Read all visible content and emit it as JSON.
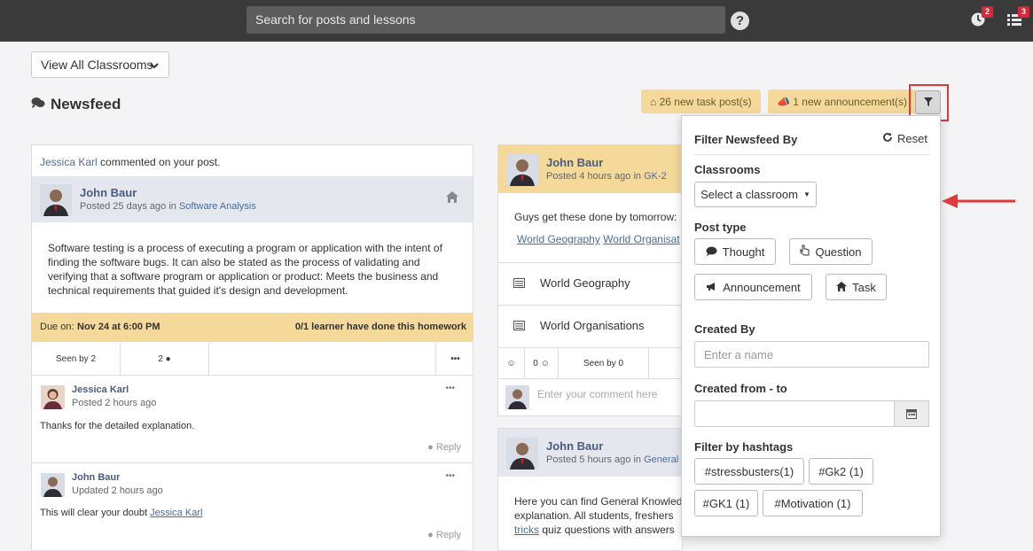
{
  "topbar": {
    "search_placeholder": "Search for posts and lessons",
    "help_label": "?",
    "notifications_count": "2",
    "list_count": "3"
  },
  "classroom_button": {
    "label": "View All Classrooms"
  },
  "newsfeed": {
    "title": "Newsfeed"
  },
  "pills": {
    "task_posts": "26 new task post(s)",
    "announcements": "1 new announcement(s)"
  },
  "left_card": {
    "notice_name": "Jessica Karl",
    "notice_text": "commented on your post.",
    "author": "John Baur",
    "posted": "Posted 25 days ago",
    "posted_in": "in",
    "classroom": "Software Analysis",
    "body": "Software testing is a process of executing a program or application with the intent of finding the software bugs. It can also be stated as the process of validating and verifying that a software program or application or product: Meets the business and technical requirements that guided it's design and development.",
    "due_label": "Due on:",
    "due_value": "Nov 24 at 6:00 PM",
    "learners": "0/1 learner have done this homework",
    "seen": "Seen by 2",
    "comments_count": "2",
    "more": "•••",
    "comments": [
      {
        "name": "Jessica Karl",
        "time": "Posted 2 hours ago",
        "text": "Thanks for the detailed explanation.",
        "reply": "Reply",
        "mention": ""
      },
      {
        "name": "John Baur",
        "time": "Updated 2 hours ago",
        "text": "This will clear your doubt",
        "reply": "Reply",
        "mention": "Jessica Karl"
      }
    ]
  },
  "mid_card_1": {
    "author": "John Baur",
    "posted": "Posted 4 hours ago",
    "posted_in": "in",
    "classroom": "GK-2",
    "body": "Guys get these done by tomorrow:",
    "link_1": "World Geography",
    "link_2": "World Organisat",
    "lessons": [
      "World Geography",
      "World Organisations"
    ],
    "reactions": "0",
    "seen": "Seen by 0",
    "comment_placeholder": "Enter your comment here"
  },
  "mid_card_2": {
    "author": "John Baur",
    "posted": "Posted 5 hours ago",
    "posted_in": "in",
    "classroom": "General Kn",
    "line_1": "Here you can find General Knowled",
    "line_2": "explanation. All students, freshers",
    "link": "tricks",
    "line_3": "quiz questions with answers"
  },
  "filter_panel": {
    "title": "Filter Newsfeed By",
    "reset": "Reset",
    "classrooms_label": "Classrooms",
    "classroom_select": "Select a classroom",
    "post_type_label": "Post type",
    "post_types": [
      "Thought",
      "Question",
      "Announcement",
      "Task"
    ],
    "created_by_label": "Created By",
    "created_by_placeholder": "Enter a name",
    "created_range_label": "Created from - to",
    "hashtags_label": "Filter by hashtags",
    "hashtags": [
      "#stressbusters(1)",
      "#Gk2 (1)",
      "#GK1 (1)",
      "#Motivation (1)"
    ]
  },
  "colors": {
    "topbar": "#3a3a3a",
    "pill": "#f5d99a",
    "due_bar": "#f5d99a",
    "highlight": "#e03a3a",
    "link": "#4a6c9b"
  }
}
